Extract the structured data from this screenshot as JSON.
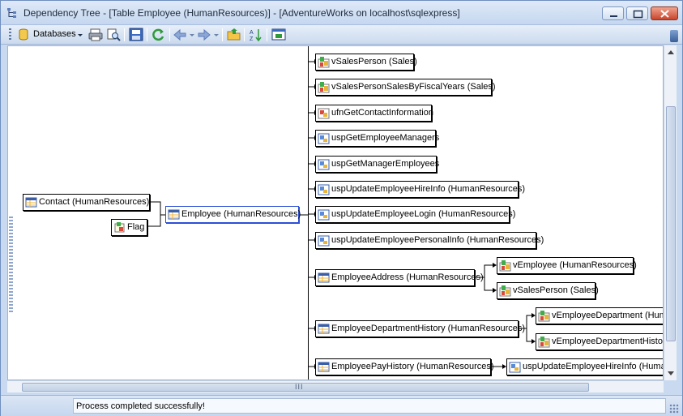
{
  "window": {
    "title": "Dependency Tree - [Table Employee (HumanResources)] - [AdventureWorks on localhost\\sqlexpress]"
  },
  "toolbar": {
    "databases_label": "Databases"
  },
  "nodes": {
    "contact": "Contact (HumanResources)",
    "flag": "Flag",
    "employee": "Employee (HumanResources)",
    "v_sales_person_sales": "vSalesPerson (Sales)",
    "v_sales_person_fiscal": "vSalesPersonSalesByFiscalYears (Sales)",
    "ufn_get_contact": "ufnGetContactInformation",
    "usp_get_emp_managers": "uspGetEmployeeManagers",
    "usp_get_mgr_employees": "uspGetManagerEmployees",
    "usp_update_hireinfo": "uspUpdateEmployeeHireInfo (HumanResources)",
    "usp_update_login": "uspUpdateEmployeeLogin (HumanResources)",
    "usp_update_personal": "uspUpdateEmployeePersonalInfo (HumanResources)",
    "employee_address": "EmployeeAddress (HumanResources)",
    "v_employee": "vEmployee (HumanResources)",
    "v_sales_person_2": "vSalesPerson (Sales)",
    "employee_dept_history": "EmployeeDepartmentHistory (HumanResources)",
    "v_employee_department": "vEmployeeDepartment (Human",
    "v_employee_dept_history": "vEmployeeDepartmentHistory",
    "employee_pay_history": "EmployeePayHistory (HumanResources)",
    "usp_update_hireinfo_2": "uspUpdateEmployeeHireInfo (HumanR"
  },
  "status": {
    "message": "Process completed successfully!"
  },
  "hscroll_grip": "III"
}
